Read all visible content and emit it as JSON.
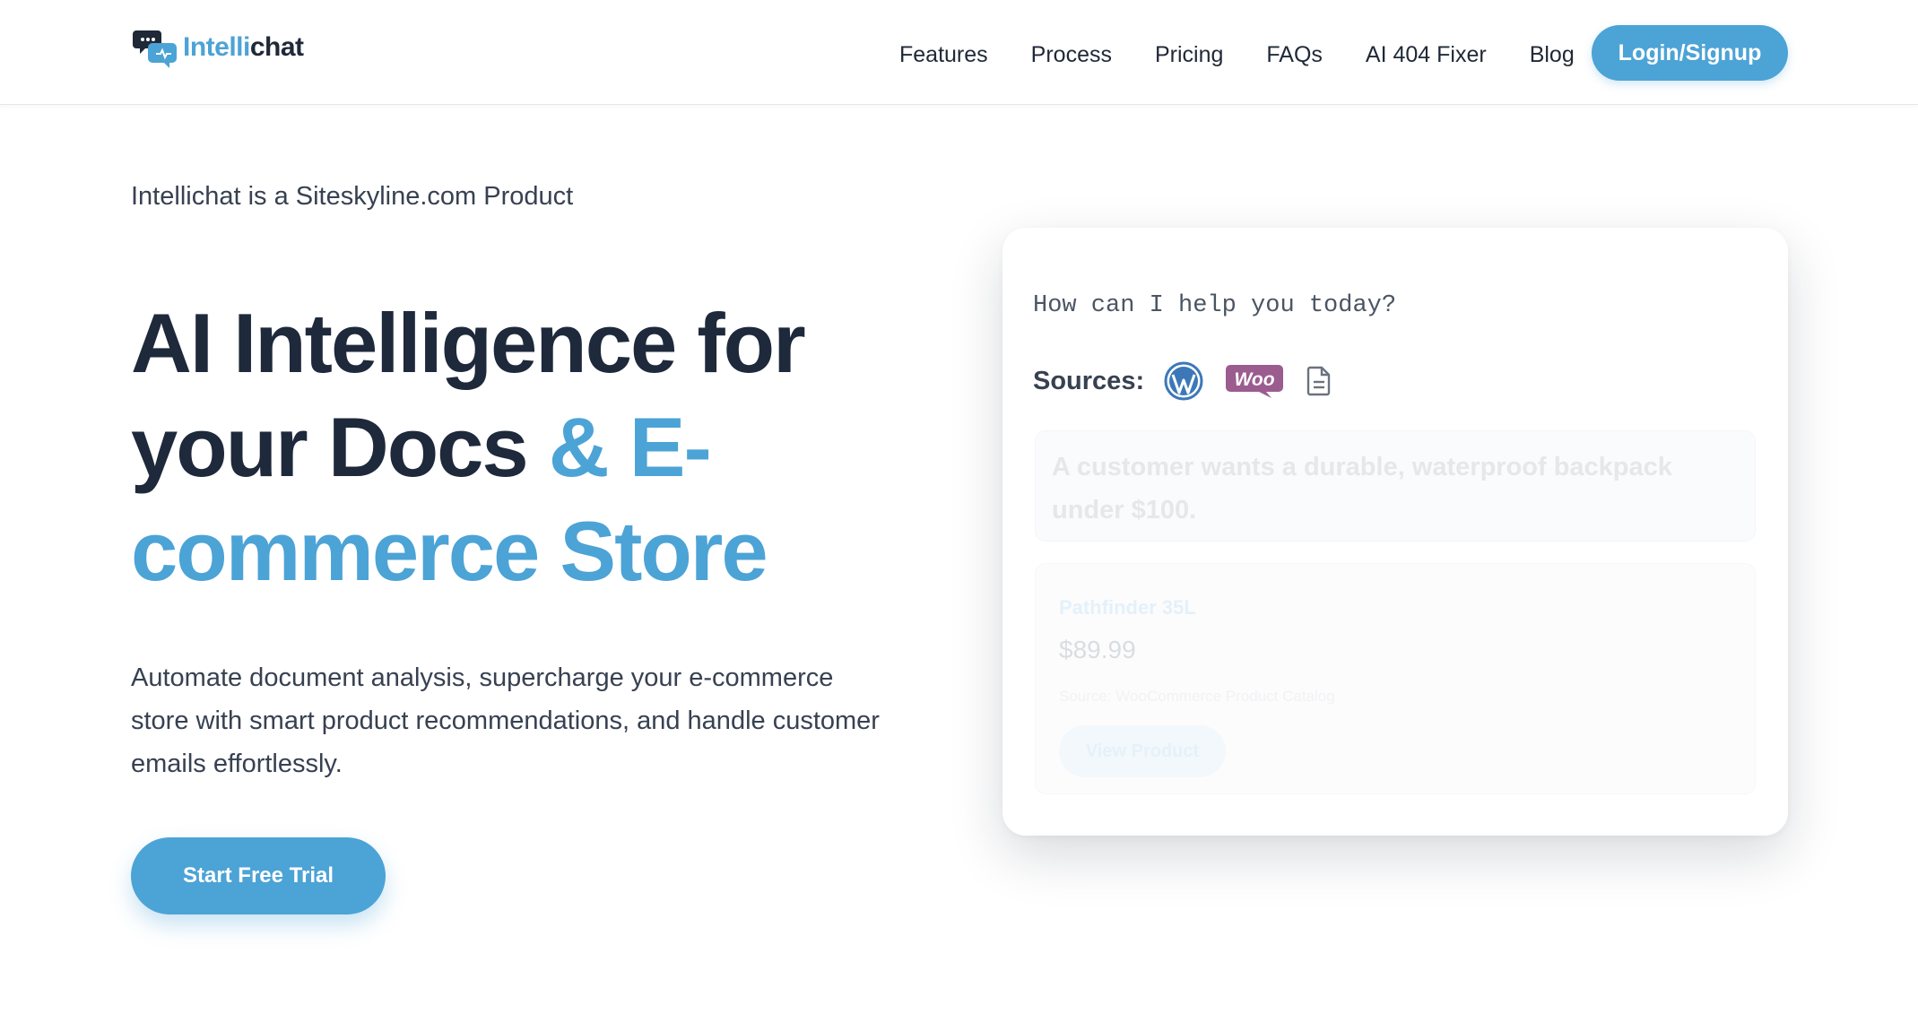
{
  "brand": {
    "name_part1": "Intelli",
    "name_part2": "chat",
    "accent_color": "#4ca3d6",
    "dark_color": "#1f2937"
  },
  "nav": {
    "links": [
      "Features",
      "Process",
      "Pricing",
      "FAQs",
      "AI 404 Fixer",
      "Blog"
    ],
    "login_label": "Login/Signup"
  },
  "hero": {
    "eyebrow": "Intellichat is a Siteskyline.com Product",
    "headline_part1": "AI Intelligence for your Docs ",
    "headline_accent": "& E-commerce Store",
    "subtext": "Automate document analysis, supercharge your e-commerce store with smart product recommendations, and handle customer emails effortlessly.",
    "cta_label": "Start Free Trial"
  },
  "chat_card": {
    "question": "How can I help you today?",
    "sources_label": "Sources:",
    "source_icons": [
      "wordpress-icon",
      "woocommerce-icon",
      "document-icon"
    ],
    "woo_badge_text": "Woo",
    "customer_message": "A customer wants a durable, waterproof backpack under $100.",
    "product": {
      "name": "Pathfinder 35L",
      "price": "$89.99",
      "source": "Source: WooCommerce Product Catalog",
      "button_label": "View Product"
    }
  }
}
